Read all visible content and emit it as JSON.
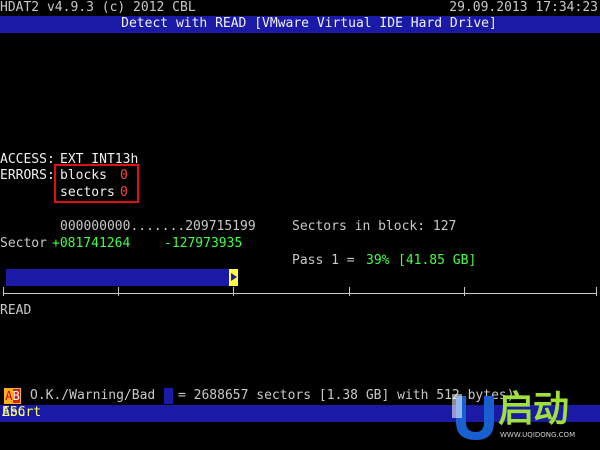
{
  "header": {
    "title": "HDAT2 v4.9.3 (c) 2012 CBL",
    "datetime": "29.09.2013 17:34:23",
    "status_bar": "Detect with READ [VMware Virtual IDE Hard Drive]"
  },
  "info": {
    "access_label": "ACCESS:",
    "access_value": "EXT INT13h",
    "errors_label": "ERRORS:",
    "blocks_label": "blocks",
    "blocks_value": "0",
    "sectors_label": "sectors",
    "sectors_value": "0"
  },
  "scan": {
    "range": "000000000.......209715199",
    "sector_label": "Sector",
    "sector_value": "+081741264",
    "sector_remaining": "-127973935",
    "sectors_in_block": "Sectors in block: 127",
    "pass_label": "Pass 1 =",
    "pass_percent": "39%",
    "pass_size": "[41.85 GB]",
    "progress_fraction": 0.39
  },
  "mode_label": "READ",
  "legend": {
    "ab_a": "A",
    "ab_b": "B",
    "text_left": "O.K./Warning/Bad (",
    "text_right": "= 2688657 sectors [1.38 GB] with 512 bytes)"
  },
  "footer": {
    "esc_key": "ESC",
    "esc_action": "Abort"
  },
  "logo": {
    "text": "启动",
    "sub": "WWW.UQIDONG.COM",
    "colors": {
      "green": "#9fe03a",
      "blue": "#1a5fd0"
    }
  },
  "colors": {
    "bar_blue": "#1a1aa6",
    "value_green": "#40ff40",
    "error_red": "#ff4040"
  }
}
